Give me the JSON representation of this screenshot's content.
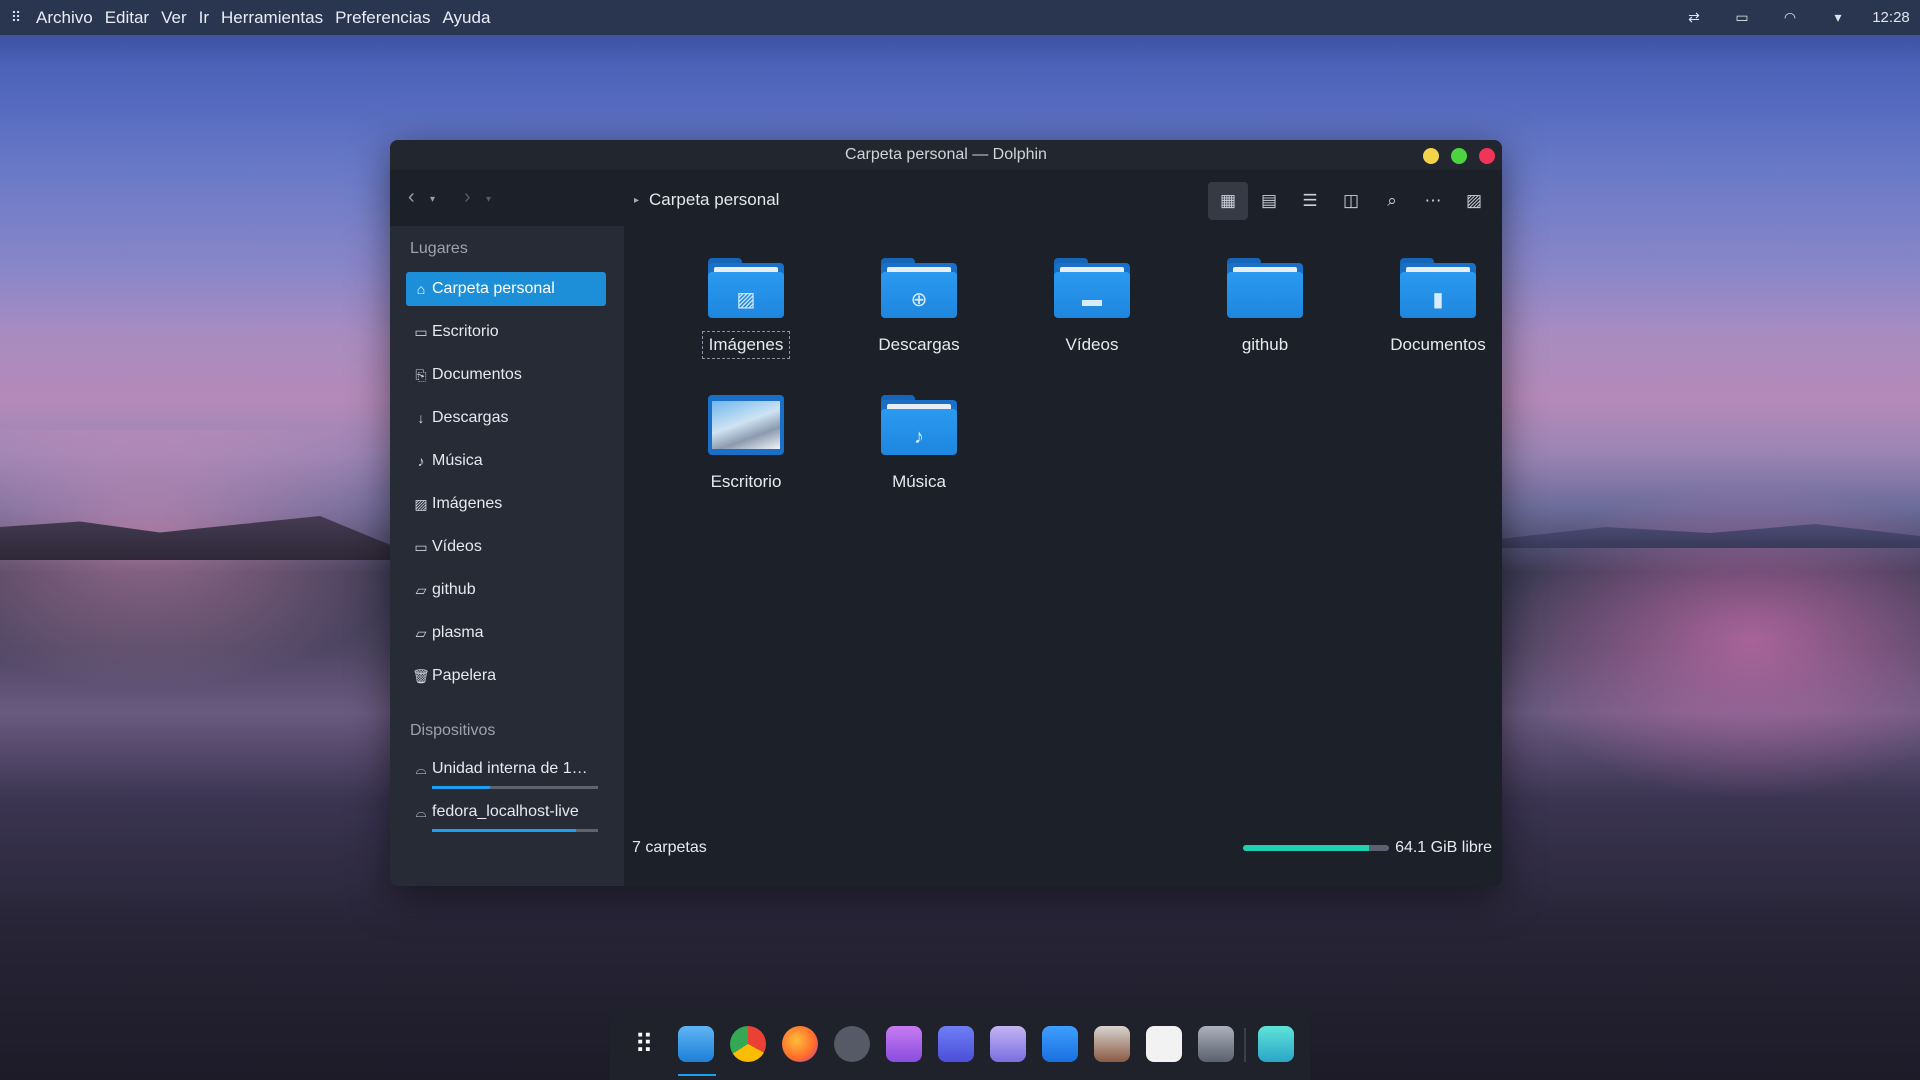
{
  "topbar": {
    "menus": [
      "Archivo",
      "Editar",
      "Ver",
      "Ir",
      "Herramientas",
      "Preferencias",
      "Ayuda"
    ],
    "clock": "12:28",
    "tray_icons": [
      "swap-icon",
      "battery-icon",
      "wifi-icon",
      "chevron-down-icon"
    ]
  },
  "window": {
    "title": "Carpeta personal — Dolphin",
    "breadcrumb": "Carpeta personal"
  },
  "sidebar": {
    "places_title": "Lugares",
    "places": [
      {
        "label": "Carpeta personal",
        "icon": "home-icon",
        "active": true
      },
      {
        "label": "Escritorio",
        "icon": "desktop-icon"
      },
      {
        "label": "Documentos",
        "icon": "documents-icon"
      },
      {
        "label": "Descargas",
        "icon": "download-icon"
      },
      {
        "label": "Música",
        "icon": "music-icon"
      },
      {
        "label": "Imágenes",
        "icon": "image-icon"
      },
      {
        "label": "Vídeos",
        "icon": "video-icon"
      },
      {
        "label": "github",
        "icon": "folder-icon"
      },
      {
        "label": "plasma",
        "icon": "folder-icon"
      },
      {
        "label": "Papelera",
        "icon": "trash-icon"
      }
    ],
    "devices_title": "Dispositivos",
    "devices": [
      {
        "label": "Unidad interna de 1…",
        "usage_fraction": 0.35
      },
      {
        "label": "fedora_localhost-live",
        "usage_fraction": 0.87
      }
    ]
  },
  "files": [
    {
      "label": "Imágenes",
      "emblem": "image-icon"
    },
    {
      "label": "Descargas",
      "emblem": "download-icon"
    },
    {
      "label": "Vídeos",
      "emblem": "video-icon"
    },
    {
      "label": "github",
      "emblem": ""
    },
    {
      "label": "Documentos",
      "emblem": "document-icon"
    },
    {
      "label": "Escritorio",
      "emblem": "desktop-icon"
    },
    {
      "label": "Música",
      "emblem": "music-icon"
    }
  ],
  "status": {
    "count": "7 carpetas",
    "free": "64.1 GiB libre",
    "free_fraction": 0.86
  },
  "colors": {
    "accent": "#1d8fd8",
    "folder": "#2b9af0",
    "free_bar": "#1fd1b0",
    "close": "#f2335a",
    "minimize": "#f2d34a",
    "maximize": "#4dd342"
  }
}
